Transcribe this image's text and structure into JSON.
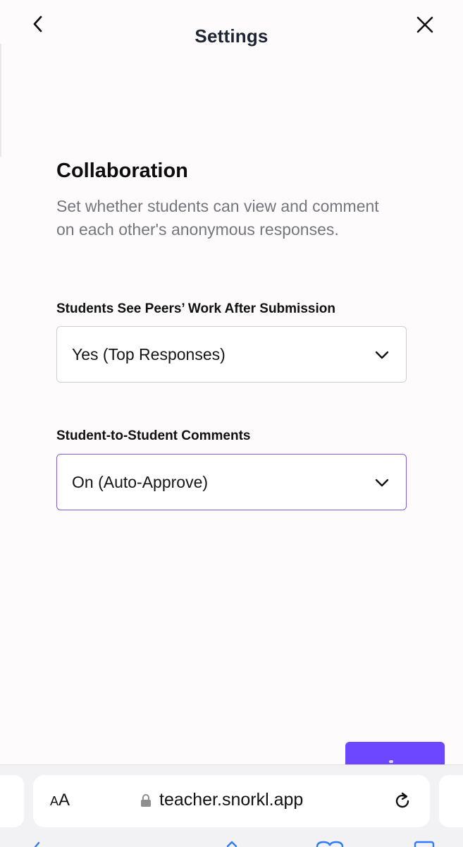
{
  "header": {
    "title": "Settings"
  },
  "section": {
    "title": "Collaboration",
    "description": "Set whether students can view and comment on each other's anonymous responses."
  },
  "fields": [
    {
      "label": "Students See Peers’ Work After Submission",
      "value": "Yes (Top Responses)",
      "focused": false
    },
    {
      "label": "Student-to-Student Comments",
      "value": "On (Auto-Approve)",
      "focused": true
    }
  ],
  "browser": {
    "text_size_small": "A",
    "text_size_large": "A",
    "url": "teacher.snorkl.app"
  },
  "colors": {
    "accent": "#6c47ff",
    "focus_border": "#7c5ce0",
    "title": "#1d2433",
    "muted_text": "#75757c",
    "browser_blue": "#2f7cf6"
  },
  "icons": [
    "back-arrow-icon",
    "close-icon",
    "chevron-down-icon",
    "lock-icon",
    "reload-icon",
    "share-icon",
    "bookmarks-icon",
    "tabs-icon"
  ]
}
